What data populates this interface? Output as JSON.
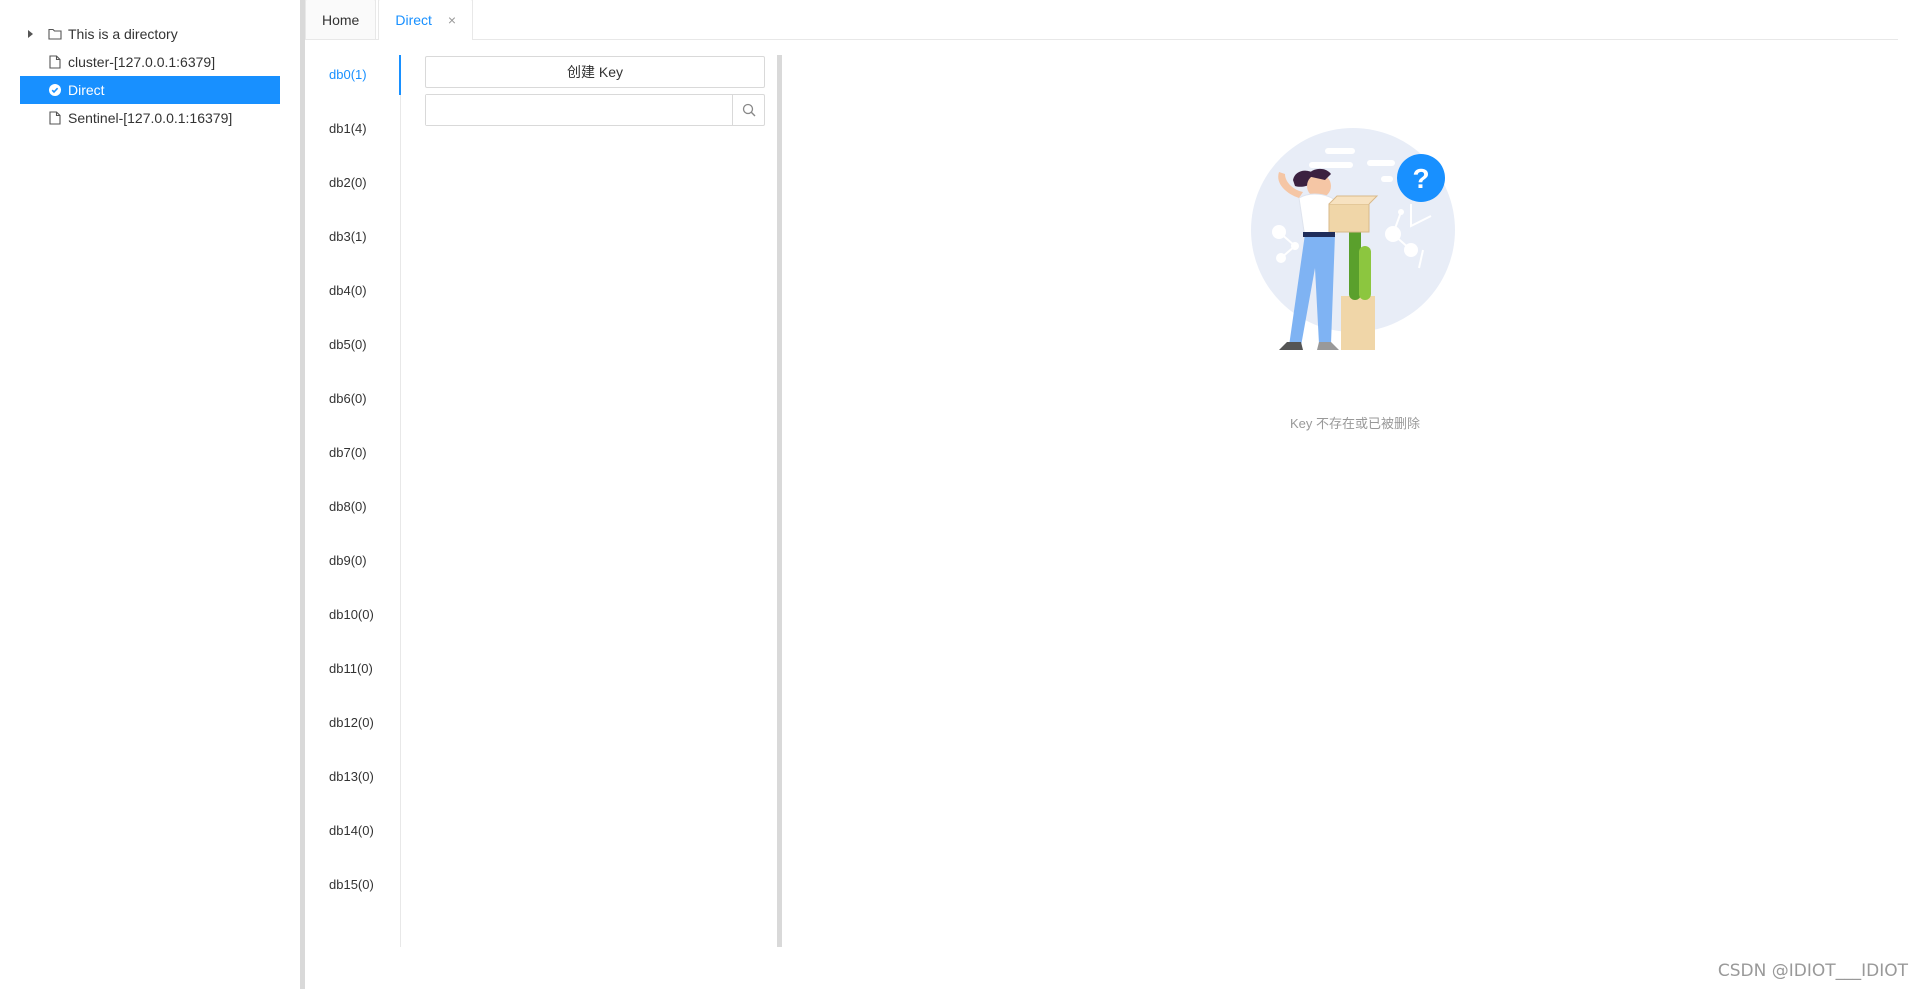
{
  "tree": {
    "nodes": [
      {
        "label": "This is a directory",
        "icon": "folder-icon"
      },
      {
        "label": "cluster-[127.0.0.1:6379]",
        "icon": "file-icon"
      },
      {
        "label": "Direct",
        "icon": "check-circle-icon"
      },
      {
        "label": "Sentinel-[127.0.0.1:16379]",
        "icon": "file-icon"
      }
    ]
  },
  "tabs": [
    {
      "label": "Home"
    },
    {
      "label": "Direct",
      "close": "×"
    }
  ],
  "dbs": [
    "db0(1)",
    "db1(4)",
    "db2(0)",
    "db3(1)",
    "db4(0)",
    "db5(0)",
    "db6(0)",
    "db7(0)",
    "db8(0)",
    "db9(0)",
    "db10(0)",
    "db11(0)",
    "db12(0)",
    "db13(0)",
    "db14(0)",
    "db15(0)"
  ],
  "key_panel": {
    "create_label": "创建 Key",
    "search_value": "",
    "search_placeholder": ""
  },
  "empty": {
    "description": "Key 不存在或已被删除",
    "badge": "?"
  },
  "watermark": "CSDN @IDIOT___IDIOT",
  "colors": {
    "accent": "#1890ff",
    "splitter": "#d9d9d9"
  }
}
